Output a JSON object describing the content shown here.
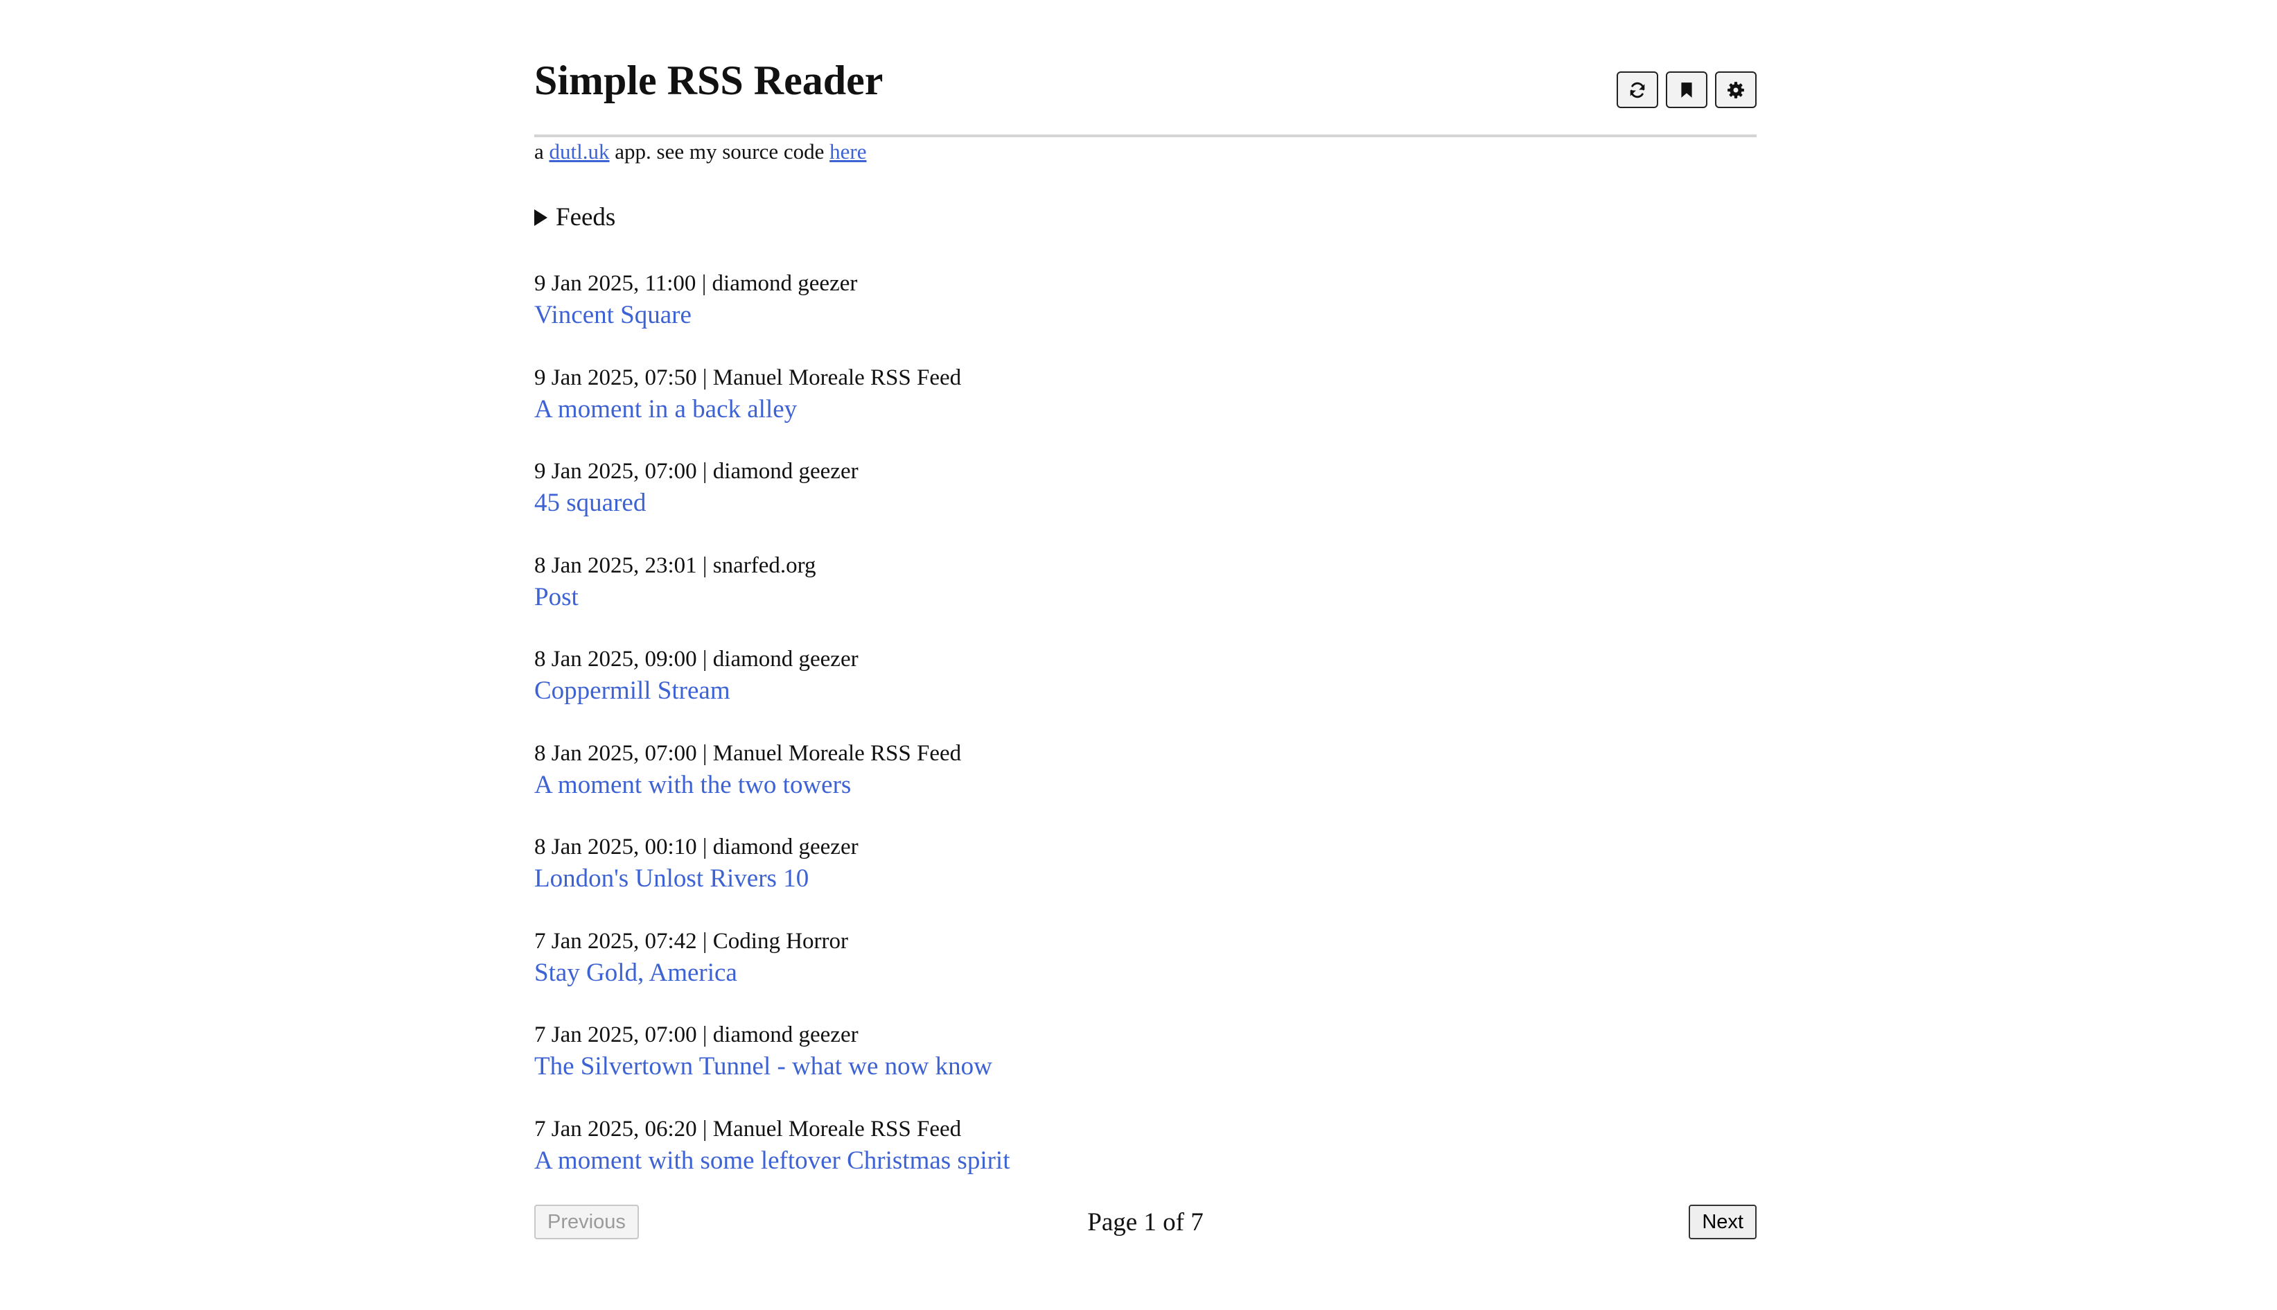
{
  "app": {
    "title": "Simple RSS Reader"
  },
  "toolbar": {
    "buttons": [
      {
        "icon": "refresh-icon",
        "label": ""
      },
      {
        "icon": "bookmark-icon",
        "label": ""
      },
      {
        "icon": "gear-icon",
        "label": ""
      }
    ]
  },
  "tagline": {
    "prefix": "a ",
    "site_link": "dutl.uk",
    "middle": " app. see my source code ",
    "source_link": "here"
  },
  "feeds": {
    "label": "Feeds",
    "expanded": false
  },
  "items": [
    {
      "date": "9 Jan 2025, 11:00",
      "source": "diamond geezer",
      "title": "Vincent Square"
    },
    {
      "date": "9 Jan 2025, 07:50",
      "source": "Manuel Moreale RSS Feed",
      "title": "A moment in a back alley"
    },
    {
      "date": "9 Jan 2025, 07:00",
      "source": "diamond geezer",
      "title": "45 squared"
    },
    {
      "date": "8 Jan 2025, 23:01",
      "source": "snarfed.org",
      "title": "Post"
    },
    {
      "date": "8 Jan 2025, 09:00",
      "source": "diamond geezer",
      "title": "Coppermill Stream"
    },
    {
      "date": "8 Jan 2025, 07:00",
      "source": "Manuel Moreale RSS Feed",
      "title": "A moment with the two towers"
    },
    {
      "date": "8 Jan 2025, 00:10",
      "source": "diamond geezer",
      "title": "London's Unlost Rivers 10"
    },
    {
      "date": "7 Jan 2025, 07:42",
      "source": "Coding Horror",
      "title": "Stay Gold, America"
    },
    {
      "date": "7 Jan 2025, 07:00",
      "source": "diamond geezer",
      "title": "The Silvertown Tunnel - what we now know"
    },
    {
      "date": "7 Jan 2025, 06:20",
      "source": "Manuel Moreale RSS Feed",
      "title": "A moment with some leftover Christmas spirit"
    }
  ],
  "pagination": {
    "previous_label": "Previous",
    "previous_disabled": true,
    "page_text": "Page 1 of 7",
    "next_label": "Next"
  },
  "colors": {
    "link": "#3d62d3",
    "divider": "#d4d4d4"
  }
}
